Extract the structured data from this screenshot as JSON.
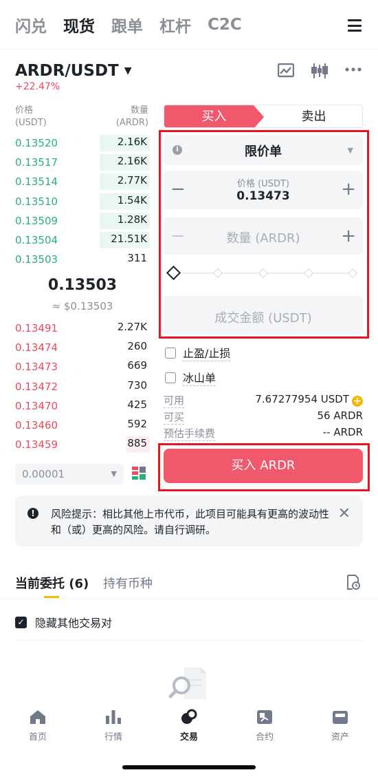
{
  "top_tabs": [
    "闪兑",
    "现货",
    "跟单",
    "杠杆",
    "C2C"
  ],
  "pair": {
    "name": "ARDR/USDT",
    "change": "+22.47%"
  },
  "orderbook": {
    "price_label": "价格",
    "price_unit": "(USDT)",
    "qty_label": "数量",
    "qty_unit": "(ARDR)",
    "asks": [
      {
        "price": "0.13520",
        "qty": "2.16K",
        "depth": 0.37
      },
      {
        "price": "0.13517",
        "qty": "2.16K",
        "depth": 0.37
      },
      {
        "price": "0.13514",
        "qty": "2.77K",
        "depth": 0.37
      },
      {
        "price": "0.13510",
        "qty": "1.54K",
        "depth": 0.37
      },
      {
        "price": "0.13509",
        "qty": "1.28K",
        "depth": 0.37
      },
      {
        "price": "0.13504",
        "qty": "21.51K",
        "depth": 0.37
      },
      {
        "price": "0.13503",
        "qty": "311",
        "depth": 0
      }
    ],
    "last_price": "0.13503",
    "last_price_usd": "≈ $0.13503",
    "bids": [
      {
        "price": "0.13491",
        "qty": "2.27K",
        "depth": 0
      },
      {
        "price": "0.13474",
        "qty": "260",
        "depth": 0
      },
      {
        "price": "0.13473",
        "qty": "669",
        "depth": 0
      },
      {
        "price": "0.13472",
        "qty": "730",
        "depth": 0
      },
      {
        "price": "0.13470",
        "qty": "425",
        "depth": 0
      },
      {
        "price": "0.13460",
        "qty": "592",
        "depth": 0
      },
      {
        "price": "0.13459",
        "qty": "885",
        "depth": 0.18
      }
    ],
    "precision": "0.00001"
  },
  "trade": {
    "buy_tab": "买入",
    "sell_tab": "卖出",
    "order_type": "限价单",
    "price_label": "价格 (USDT)",
    "price_value": "0.13473",
    "qty_placeholder": "数量 (ARDR)",
    "total_placeholder": "成交金额 (USDT)",
    "tp_sl": "止盈/止损",
    "iceberg": "冰山单",
    "available_label": "可用",
    "available_value": "7.67277954 USDT",
    "can_buy_label": "可买",
    "can_buy_value": "56 ARDR",
    "fee_label": "预估手续费",
    "fee_value": "-- ARDR",
    "buy_button": "买入 ARDR",
    "accent": "#f0596b"
  },
  "risk": {
    "text": "风险提示：相比其他上市代币，此项目可能具有更高的波动性和（或）更高的风险。请自行调研。"
  },
  "orders": {
    "tab_open": "当前委托 (6)",
    "tab_holdings": "持有币种",
    "hide_others": "隐藏其他交易对"
  },
  "nav": [
    {
      "label": "首页",
      "icon": "home-icon"
    },
    {
      "label": "行情",
      "icon": "markets-icon"
    },
    {
      "label": "交易",
      "icon": "trade-icon"
    },
    {
      "label": "合约",
      "icon": "futures-icon"
    },
    {
      "label": "资产",
      "icon": "wallet-icon"
    }
  ]
}
